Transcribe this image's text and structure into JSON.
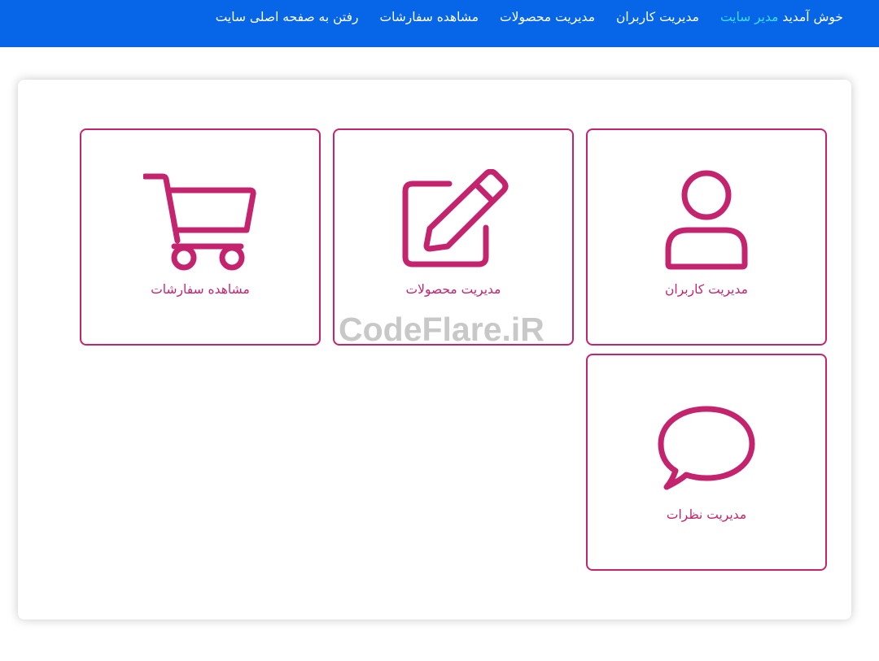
{
  "nav": {
    "welcome_prefix": "خوش آمدید",
    "welcome_user": "مدیر سایت",
    "links": [
      {
        "label": "مدیریت کاربران"
      },
      {
        "label": "مدیریت محصولات"
      },
      {
        "label": "مشاهده سفارشات"
      },
      {
        "label": "رفتن به صفحه اصلی سایت"
      }
    ]
  },
  "cards": [
    {
      "label": "مدیریت کاربران",
      "icon": "user-icon"
    },
    {
      "label": "مدیریت محصولات",
      "icon": "edit-icon"
    },
    {
      "label": "مشاهده سفارشات",
      "icon": "cart-icon"
    },
    {
      "label": "مدیریت نظرات",
      "icon": "comment-icon"
    }
  ],
  "watermark": "CodeFlare.iR",
  "colors": {
    "navbar": "#0766e8",
    "accent": "#c4246e",
    "welcome_user": "#39e0f5",
    "watermark": "#c8c8c8"
  }
}
